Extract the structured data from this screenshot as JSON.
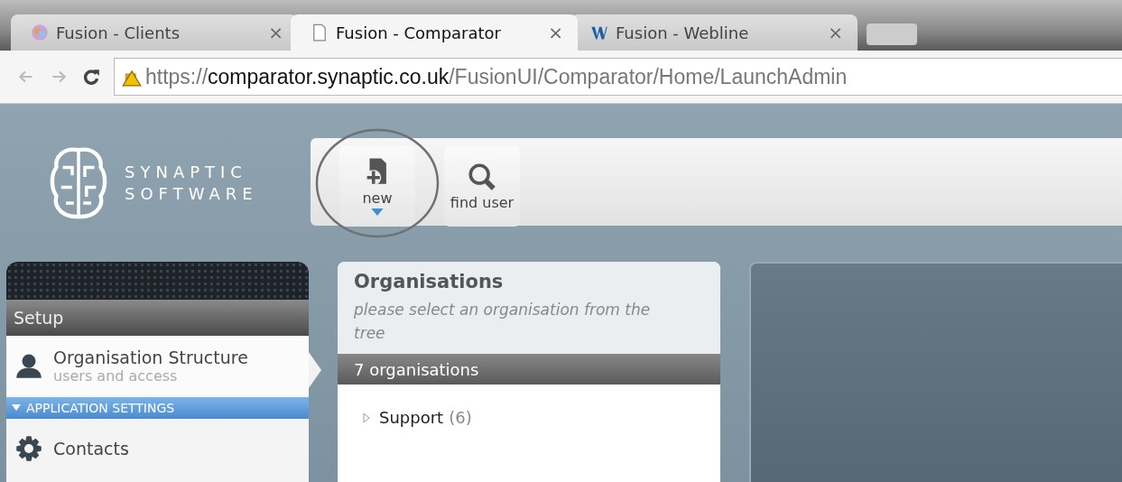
{
  "browser": {
    "tabs": [
      {
        "title": "Fusion - Clients",
        "close": "×",
        "kind": "brain",
        "selected": false
      },
      {
        "title": "Fusion - Comparator",
        "close": "×",
        "kind": "page",
        "selected": true
      },
      {
        "title": "Fusion - Webline",
        "close": "×",
        "kind": "w",
        "selected": false
      }
    ],
    "address": {
      "scheme": "https://",
      "host": "comparator.synaptic.co.uk",
      "path": "/FusionUI/Comparator/Home/LaunchAdmin"
    }
  },
  "logo": {
    "line_1": "SYNAPTIC",
    "line_2": "SOFTWARE"
  },
  "toolbar": [
    {
      "label": "new",
      "kind": "new",
      "highlighted": true
    },
    {
      "label": "find user",
      "kind": "search",
      "highlighted": false
    }
  ],
  "sidebar": {
    "title": "Setup",
    "items": [
      {
        "kind": "person",
        "label": "Organisation Structure",
        "sublabel": "users and access",
        "selected": true
      },
      {
        "kind": "section",
        "label": "APPLICATION SETTINGS",
        "expanded": true
      },
      {
        "kind": "gear",
        "label": "Contacts",
        "selected": false
      }
    ]
  },
  "organisations": {
    "title": "Organisations",
    "hint": "please select an organisation from the tree",
    "count": "7 organisations",
    "tree": [
      {
        "label": "Support",
        "count": "(6)",
        "expanded": false
      }
    ]
  }
}
